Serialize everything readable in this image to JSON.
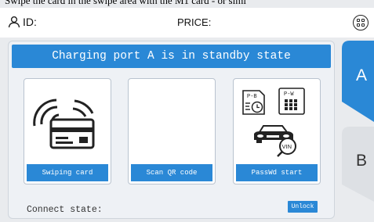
{
  "top_text": "Swipe the card in the swipe area with the M1 card - or simi",
  "header": {
    "id_label": "ID:",
    "price_label": "PRICE:"
  },
  "banner": {
    "text": "Charging port A is in standby state"
  },
  "cards": [
    {
      "label": "Swiping card",
      "icon": "card-swipe-icon"
    },
    {
      "label": "Scan QR code",
      "icon": "qr-code-area"
    },
    {
      "label": "PassWd start",
      "icon": "password-vin-icon"
    }
  ],
  "mini_icons": {
    "pb": "P-B",
    "pw": "P-W",
    "vin": "VIN"
  },
  "footer": {
    "connect_label": "Connect state:",
    "unlock_label": "Unlock"
  },
  "ports": [
    {
      "label": "A",
      "active": true
    },
    {
      "label": "B",
      "active": false
    }
  ],
  "colors": {
    "accent": "#2a88d6",
    "header_bg": "#ffffff",
    "page_bg": "#e9ebee",
    "panel_bg": "#eef1f5"
  }
}
